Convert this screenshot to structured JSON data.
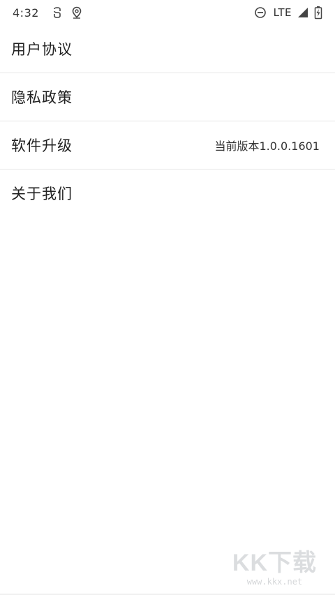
{
  "status_bar": {
    "time": "4:32",
    "network": "LTE",
    "icons": [
      "sync-icon",
      "location-icon",
      "dnd-icon",
      "signal-icon",
      "battery-charging-icon"
    ]
  },
  "settings": {
    "items": [
      {
        "label": "用户协议",
        "value": ""
      },
      {
        "label": "隐私政策",
        "value": ""
      },
      {
        "label": "软件升级",
        "value": "当前版本1.0.0.1601"
      },
      {
        "label": "关于我们",
        "value": ""
      }
    ]
  },
  "watermark": {
    "logo_text": "KK下载",
    "url": "www.kkx.net"
  }
}
